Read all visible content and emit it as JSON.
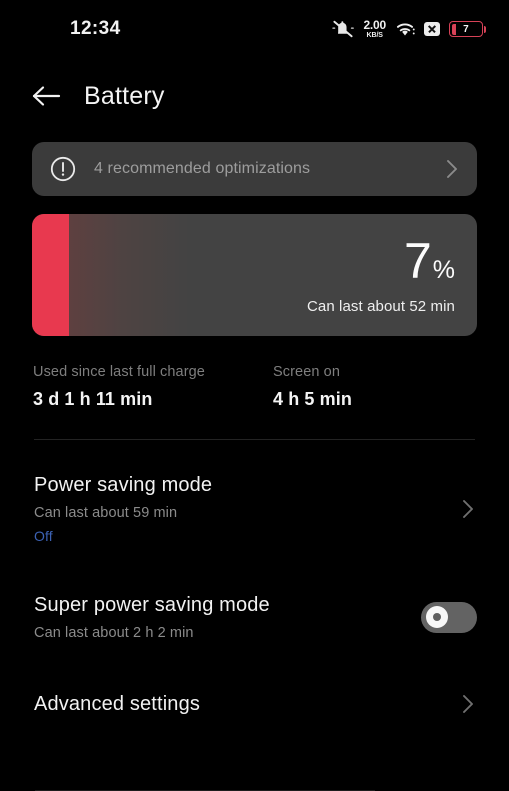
{
  "status_bar": {
    "clock": "12:34",
    "mute_icon": "bell-muted-icon",
    "network_speed_value": "2.00",
    "network_speed_unit": "KB/S",
    "wifi_icon": "wifi-icon",
    "no_sim_icon": "no-sim-x-icon",
    "battery_level": "7",
    "battery_icon": "battery-low-icon"
  },
  "header": {
    "back_icon": "back-arrow-icon",
    "title": "Battery"
  },
  "optimization_banner": {
    "icon": "exclamation-circle-icon",
    "text": "4 recommended optimizations",
    "chevron_icon": "chevron-right-icon"
  },
  "battery_card": {
    "percent_number": "7",
    "percent_symbol": "%",
    "estimate": "Can last about 52 min",
    "fill_color": "#e8394f",
    "card_color": "#434343",
    "fill_ratio_percent": 8
  },
  "stats": [
    {
      "label": "Used since last full charge",
      "value": "3 d 1 h 11 min"
    },
    {
      "label": "Screen on",
      "value": "4 h 5 min"
    }
  ],
  "settings": {
    "power_saving": {
      "title": "Power saving mode",
      "subtitle": "Can last about 59 min",
      "state": "Off",
      "state_color": "#3c62b4",
      "chevron_icon": "chevron-right-icon"
    },
    "super_power_saving": {
      "title": "Super power saving mode",
      "subtitle": "Can last about 2 h 2 min",
      "toggle_state": "off",
      "toggle_icon": "toggle-switch-off-icon"
    },
    "advanced": {
      "title": "Advanced settings",
      "chevron_icon": "chevron-right-icon"
    }
  }
}
